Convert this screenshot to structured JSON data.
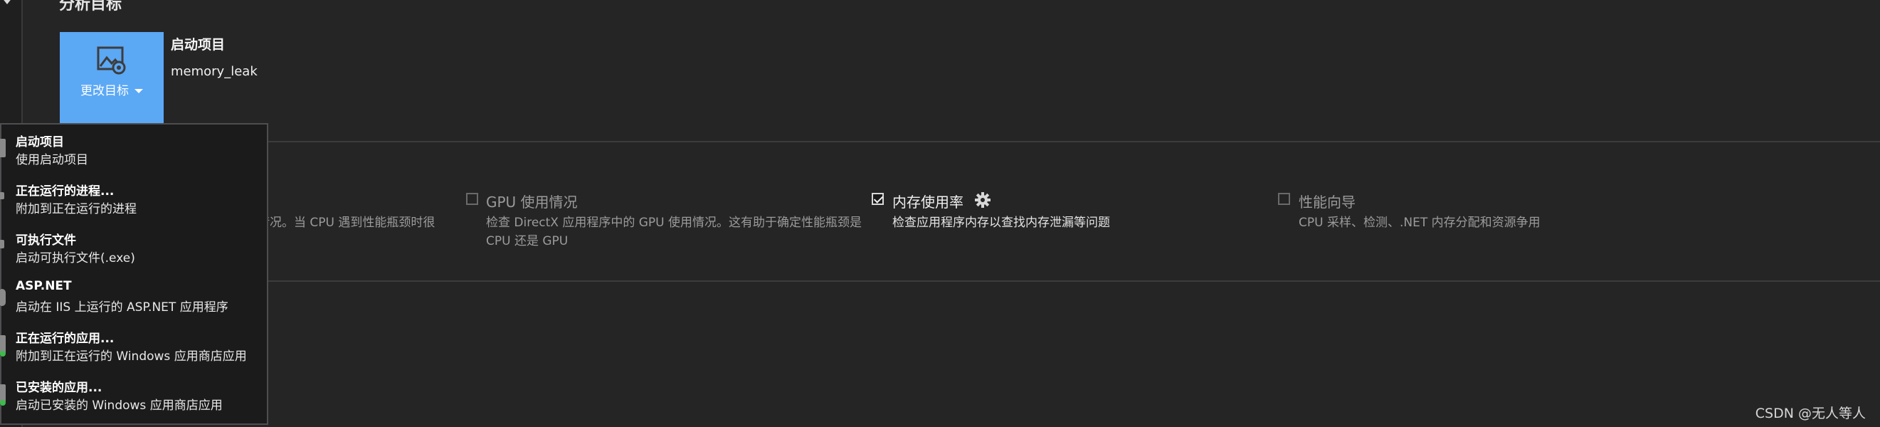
{
  "analysis_target": {
    "section_title": "分析目标",
    "tile_label": "更改目标",
    "heading": "启动项目",
    "name": "memory_leak"
  },
  "tools": [
    {
      "title": "",
      "description": "情况。当 CPU 遇到性能瓶颈时很",
      "checked": false
    },
    {
      "title": "GPU 使用情况",
      "description": "检查 DirectX 应用程序中的 GPU 使用情况。这有助于确定性能瓶颈是 CPU 还是 GPU",
      "checked": false
    },
    {
      "title": "内存使用率",
      "description": "检查应用程序内存以查找内存泄漏等问题",
      "checked": true,
      "settings_icon": "gear-icon"
    },
    {
      "title": "性能向导",
      "description": "CPU 采样、检测、.NET 内存分配和资源争用",
      "checked": false
    }
  ],
  "target_menu": [
    {
      "title": "启动项目",
      "description": "使用启动项目",
      "icon": "project-icon"
    },
    {
      "title": "正在运行的进程...",
      "description": "附加到正在运行的进程",
      "icon": "process-icon"
    },
    {
      "title": "可执行文件",
      "description": "启动可执行文件(.exe)",
      "icon": "executable-icon"
    },
    {
      "title": "ASP.NET",
      "description": "启动在 IIS 上运行的 ASP.NET 应用程序",
      "icon": "globe-icon"
    },
    {
      "title": "正在运行的应用...",
      "description": "附加到正在运行的 Windows 应用商店应用",
      "icon": "running-app-icon"
    },
    {
      "title": "已安装的应用...",
      "description": "启动已安装的 Windows 应用商店应用",
      "icon": "installed-app-icon"
    }
  ],
  "watermark": "CSDN @无人等人",
  "colors": {
    "background": "#252526",
    "tile_accent": "#5ba8f5",
    "menu_background": "#1b1b1c",
    "status_green": "#3cbc4a"
  }
}
